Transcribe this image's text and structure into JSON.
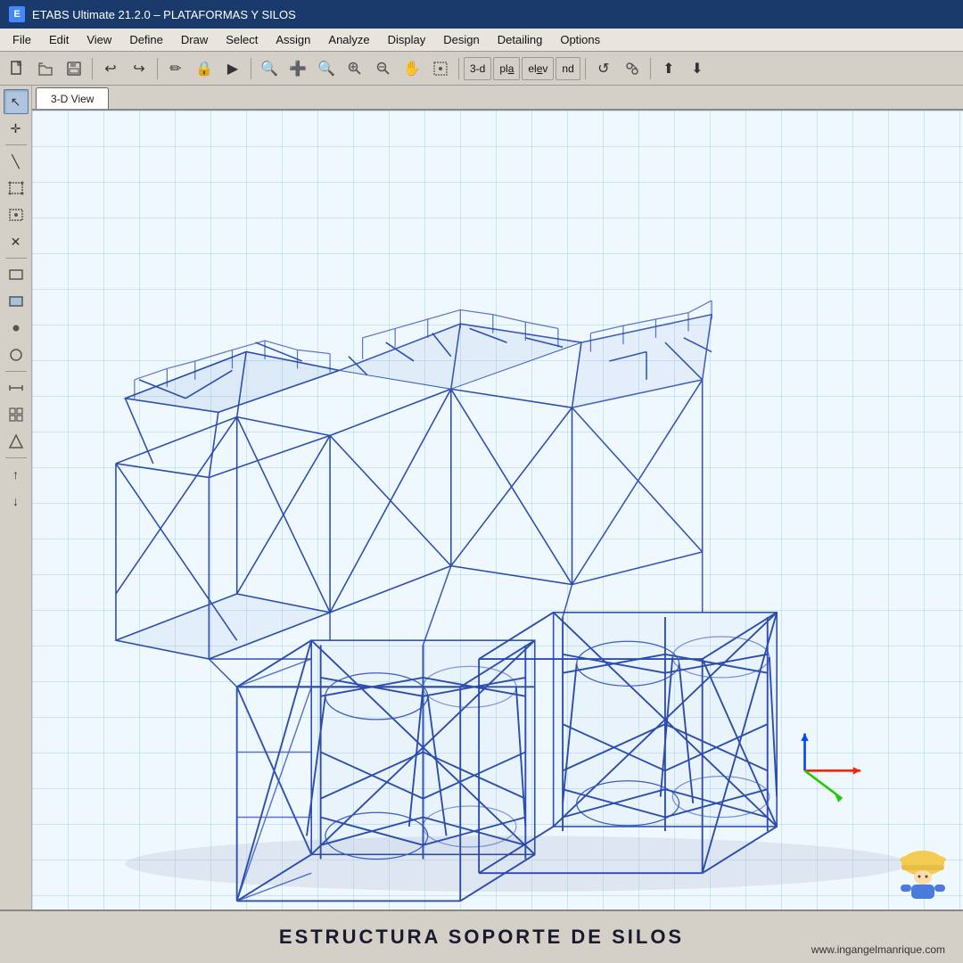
{
  "titlebar": {
    "app_icon": "E",
    "title": "ETABS Ultimate 21.2.0 – PLATAFORMAS Y SILOS"
  },
  "menubar": {
    "items": [
      "File",
      "Edit",
      "View",
      "Define",
      "Draw",
      "Select",
      "Assign",
      "Analyze",
      "Display",
      "Design",
      "Detailing",
      "Options"
    ]
  },
  "toolbar": {
    "view_buttons": [
      "3-d",
      "pla",
      "ele",
      "nd"
    ],
    "text_buttons": [
      "3-d",
      "pla",
      "ele",
      "nd"
    ]
  },
  "left_toolbar": {
    "buttons": [
      {
        "name": "select-pointer",
        "icon": "↖"
      },
      {
        "name": "rubber-band",
        "icon": "✛"
      },
      {
        "name": "draw-line",
        "icon": "╲"
      },
      {
        "name": "select-rect",
        "icon": "⬜"
      },
      {
        "name": "select-polygon",
        "icon": "▣"
      },
      {
        "name": "select-intersect",
        "icon": "✕"
      },
      {
        "name": "draw-frame",
        "icon": "▭"
      },
      {
        "name": "draw-area",
        "icon": "◻"
      },
      {
        "name": "draw-node",
        "icon": "•"
      },
      {
        "name": "draw-circle",
        "icon": "○"
      },
      {
        "name": "separator1",
        "icon": ""
      },
      {
        "name": "measure",
        "icon": "📏"
      },
      {
        "name": "grid",
        "icon": "⊞"
      },
      {
        "name": "triangle",
        "icon": "△"
      },
      {
        "name": "arrow-up",
        "icon": "↑"
      }
    ]
  },
  "view_tab": {
    "label": "3-D View"
  },
  "structure": {
    "description": "3D wireframe structure of platforms and silos"
  },
  "footer": {
    "title": "ESTRUCTURA SOPORTE DE SILOS",
    "website": "www.ingangelmanrique.com"
  },
  "axes": {
    "x_color": "#ff2200",
    "y_color": "#22cc00",
    "z_color": "#0044ff"
  }
}
